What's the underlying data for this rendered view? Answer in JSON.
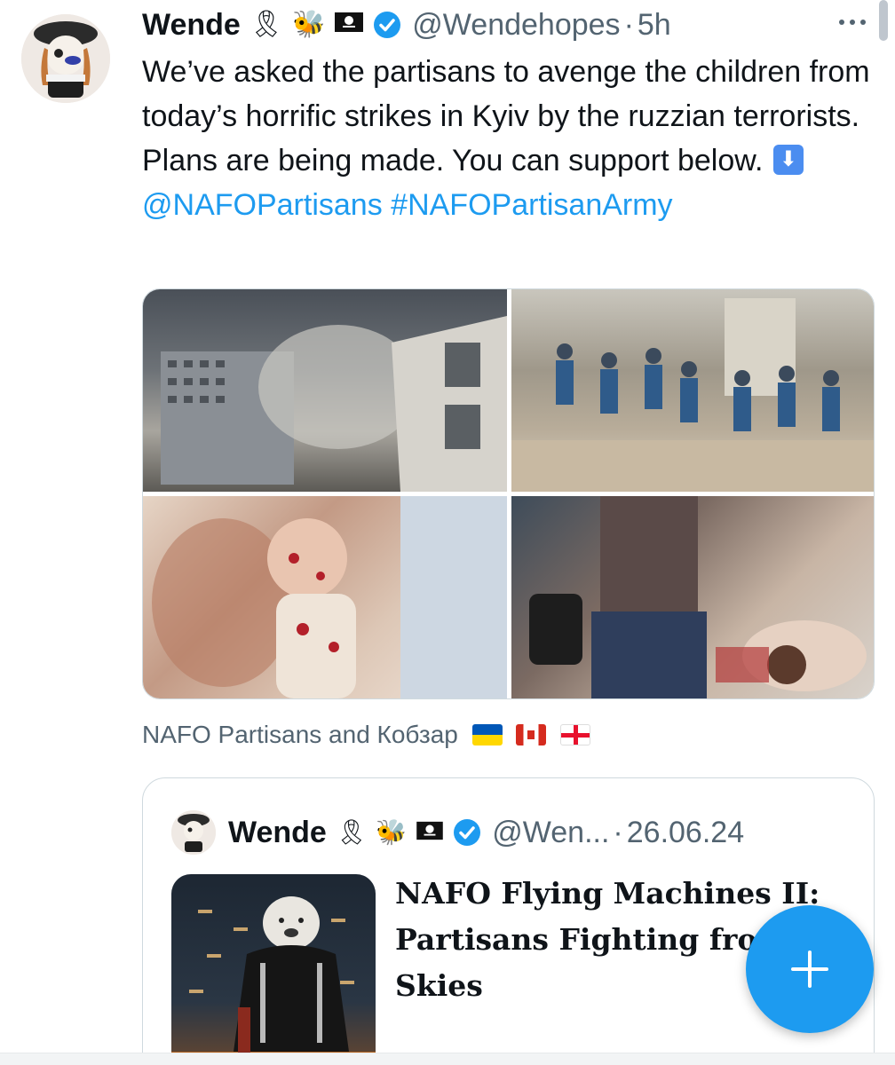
{
  "tweet": {
    "author_name": "Wende",
    "handle": "@Wendehopes",
    "separator": "·",
    "time": "5h",
    "text_part1": "We’ve asked the partisans to avenge the children from today’s horrific strikes in Kyiv by the ruzzian terrorists. Plans are being made. You can support below.",
    "mention": "@NAFOPartisans",
    "hashtag": "#NAFOPartisanArmy",
    "media_caption": "NAFO Partisans and Кобзар",
    "emojis": [
      "ribbon-emoji",
      "bee-emoji",
      "pirate-flag-emoji"
    ]
  },
  "quote": {
    "author_name": "Wende",
    "handle": "@Wen...",
    "separator": "·",
    "date": "26.06.24",
    "card_title": "NAFO Flying Machines II: Partisans Fighting from the Skies"
  },
  "colors": {
    "accent": "#1d9bf0",
    "text": "#0f1419",
    "muted": "#536471",
    "border": "#cfd9de"
  }
}
